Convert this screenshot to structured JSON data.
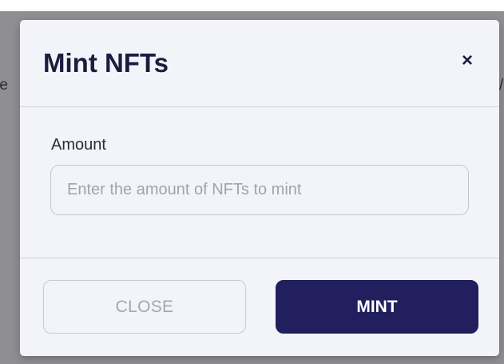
{
  "backdrop": {
    "left_fragment": "ne",
    "right_fragment": "/"
  },
  "modal": {
    "title": "Mint NFTs",
    "close_glyph": "×",
    "close_icon": "close-icon",
    "amount_label": "Amount",
    "amount_value": "",
    "amount_placeholder": "Enter the amount of NFTs to mint",
    "close_button_label": "CLOSE",
    "mint_button_label": "MINT"
  },
  "colors": {
    "primary": "#221f5e",
    "title": "#1d1c3f",
    "modal_bg": "#f3f4f9",
    "overlay": "#8f8f92"
  }
}
